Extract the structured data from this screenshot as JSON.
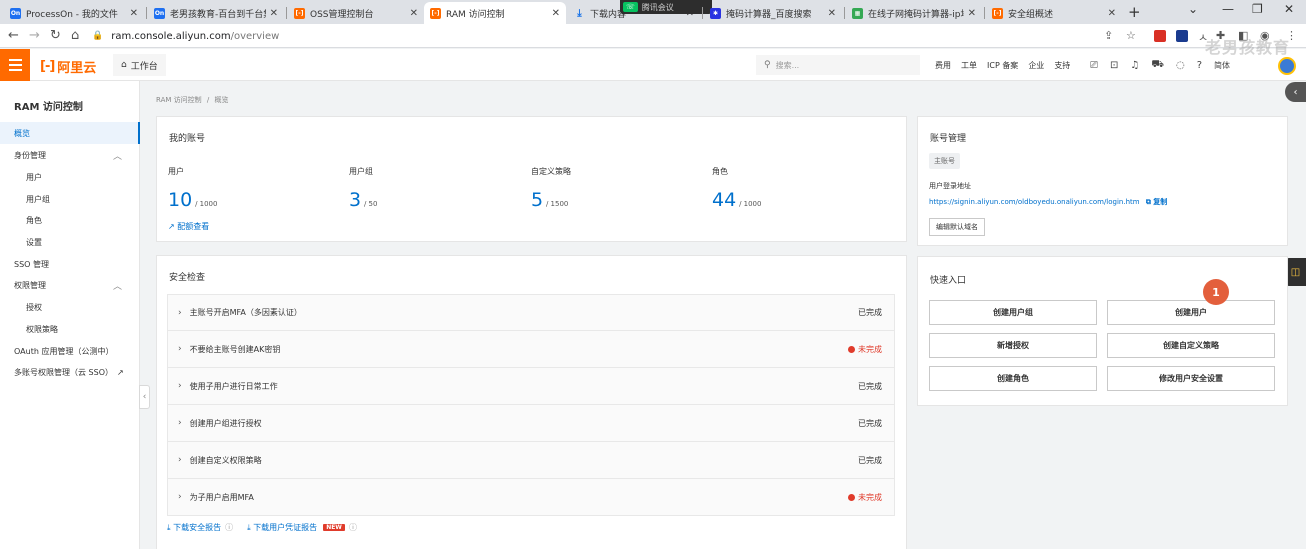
{
  "browser": {
    "tabs": [
      {
        "title": "ProcessOn - 我的文件",
        "favicon": "On",
        "favicon_color": "#1e6ff0"
      },
      {
        "title": "老男孩教育-百台到千台集群",
        "favicon": "On",
        "favicon_color": "#1e6ff0"
      },
      {
        "title": "OSS管理控制台",
        "favicon": "[-]",
        "favicon_color": "#ff6a00"
      },
      {
        "title": "RAM 访问控制",
        "favicon": "[-]",
        "favicon_color": "#ff6a00",
        "active": true
      },
      {
        "title": "下载内容",
        "favicon": "download-icon",
        "favicon_color": "#1a73e8"
      },
      {
        "title": "掩码计算器_百度搜索",
        "favicon": "paw-icon",
        "favicon_color": "#2932e1"
      },
      {
        "title": "在线子网掩码计算器-ip地址",
        "favicon": "calc-icon",
        "favicon_color": "#34a853"
      },
      {
        "title": "安全组概述",
        "favicon": "[-]",
        "favicon_color": "#ff6a00"
      }
    ],
    "meeting_badge": "腾讯会议",
    "address": {
      "host": "ram.console.aliyun.com",
      "path": "/overview"
    }
  },
  "topbar": {
    "logo_text": "阿里云",
    "workbench": "工作台",
    "search_placeholder": "搜索...",
    "links": [
      "费用",
      "工单",
      "ICP 备案",
      "企业",
      "支持"
    ],
    "lang": "简体",
    "watermark": "老男孩教育"
  },
  "sidebar": {
    "title": "RAM 访问控制",
    "items": [
      {
        "label": "概览",
        "active": true
      },
      {
        "label": "身份管理",
        "expandable": true
      },
      {
        "label": "用户",
        "sub": true
      },
      {
        "label": "用户组",
        "sub": true
      },
      {
        "label": "角色",
        "sub": true
      },
      {
        "label": "设置",
        "sub": true
      },
      {
        "label": "SSO 管理"
      },
      {
        "label": "权限管理",
        "expandable": true
      },
      {
        "label": "授权",
        "sub": true
      },
      {
        "label": "权限策略",
        "sub": true
      },
      {
        "label": "OAuth 应用管理（公测中）"
      },
      {
        "label": "多账号权限管理（云 SSO）",
        "external": true
      }
    ]
  },
  "breadcrumb": [
    "RAM 访问控制",
    "/",
    "概览"
  ],
  "my_account": {
    "title": "我的账号",
    "stats": [
      {
        "label": "用户",
        "value": "10",
        "max": "/ 1000"
      },
      {
        "label": "用户组",
        "value": "3",
        "max": "/ 50"
      },
      {
        "label": "自定义策略",
        "value": "5",
        "max": "/ 1500"
      },
      {
        "label": "角色",
        "value": "44",
        "max": "/ 1000"
      }
    ],
    "quota_link": "配额查看"
  },
  "security_check": {
    "title": "安全检查",
    "items": [
      {
        "label": "主账号开启MFA（多因素认证）",
        "status": "已完成",
        "done": true
      },
      {
        "label": "不要给主账号创建AK密钥",
        "status": "未完成",
        "done": false
      },
      {
        "label": "使用子用户进行日常工作",
        "status": "已完成",
        "done": true
      },
      {
        "label": "创建用户组进行授权",
        "status": "已完成",
        "done": true
      },
      {
        "label": "创建自定义权限策略",
        "status": "已完成",
        "done": true
      },
      {
        "label": "为子用户启用MFA",
        "status": "未完成",
        "done": false
      }
    ],
    "download_report": "下载安全报告",
    "download_credential": "下载用户凭证报告",
    "new_badge": "NEW"
  },
  "account_mgmt": {
    "title": "账号管理",
    "tag": "主账号",
    "login_label": "用户登录地址",
    "login_url": "https://signin.aliyun.com/oldboyedu.onaliyun.com/login.htm",
    "copy_label": "复制",
    "edit_default_domain": "编辑默认域名"
  },
  "quick_entry": {
    "title": "快速入口",
    "buttons": [
      "创建用户组",
      "创建用户",
      "新增授权",
      "创建自定义策略",
      "创建角色",
      "修改用户安全设置"
    ],
    "annotation_badge": "1"
  },
  "colors": {
    "brand": "#ff6a00",
    "link": "#0070cc",
    "danger": "#e03b2b"
  }
}
